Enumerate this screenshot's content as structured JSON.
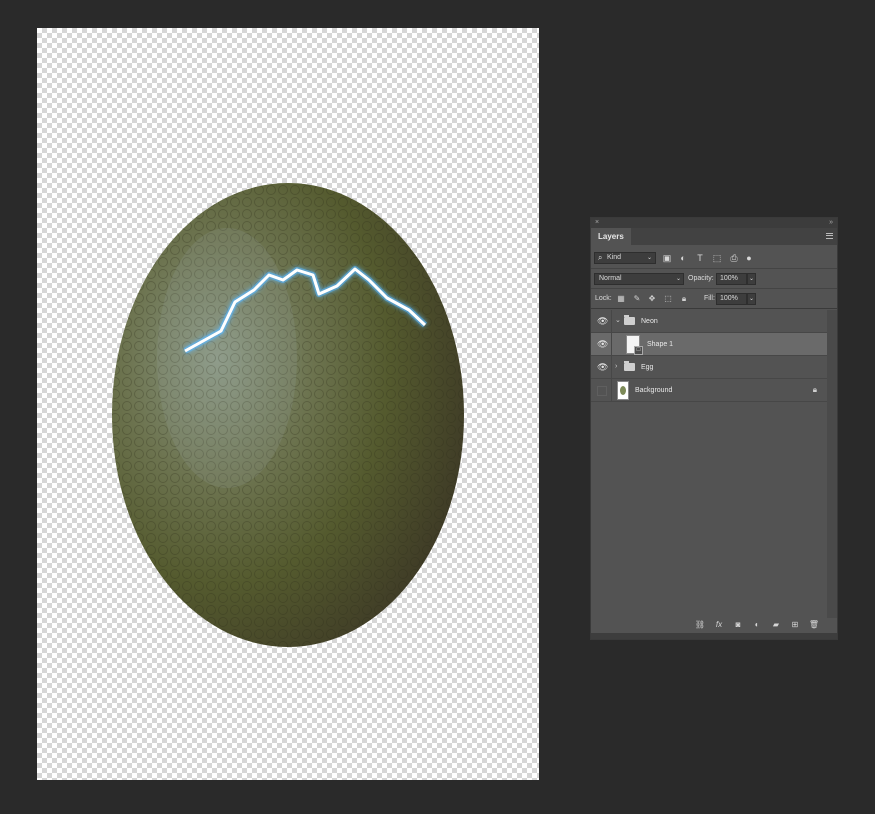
{
  "panel": {
    "tab_label": "Layers",
    "filter": {
      "kind_label": "Kind"
    },
    "blend_mode": "Normal",
    "opacity_label": "Opacity:",
    "opacity_value": "100%",
    "lock_label": "Lock:",
    "fill_label": "Fill:",
    "fill_value": "100%",
    "layers": [
      {
        "name": "Neon",
        "type": "group",
        "expanded": true,
        "visible": true
      },
      {
        "name": "Shape 1",
        "type": "shape",
        "selected": true,
        "visible": true
      },
      {
        "name": "Egg",
        "type": "group",
        "expanded": false,
        "visible": true
      },
      {
        "name": "Background",
        "type": "image",
        "visible": false,
        "locked": true
      }
    ],
    "icons": {
      "filter_icons": [
        "image-filter-icon",
        "adjustment-filter-icon",
        "type-filter-icon",
        "shape-filter-icon",
        "smart-object-filter-icon",
        "filter-toggle-icon"
      ],
      "lock_icons": [
        "lock-transparent-pixels-icon",
        "lock-image-pixels-icon",
        "lock-position-icon",
        "lock-artboard-icon",
        "lock-all-icon"
      ],
      "footer_icons": [
        "link-layers-icon",
        "fx-icon",
        "add-mask-icon",
        "adjustment-layer-icon",
        "new-group-icon",
        "new-layer-icon",
        "delete-layer-icon"
      ]
    }
  },
  "colors": {
    "app_background": "#2a2a2a",
    "panel_background": "#535353",
    "selected_layer": "#6a6a6a",
    "neon_glow": "#5ab8ff"
  }
}
